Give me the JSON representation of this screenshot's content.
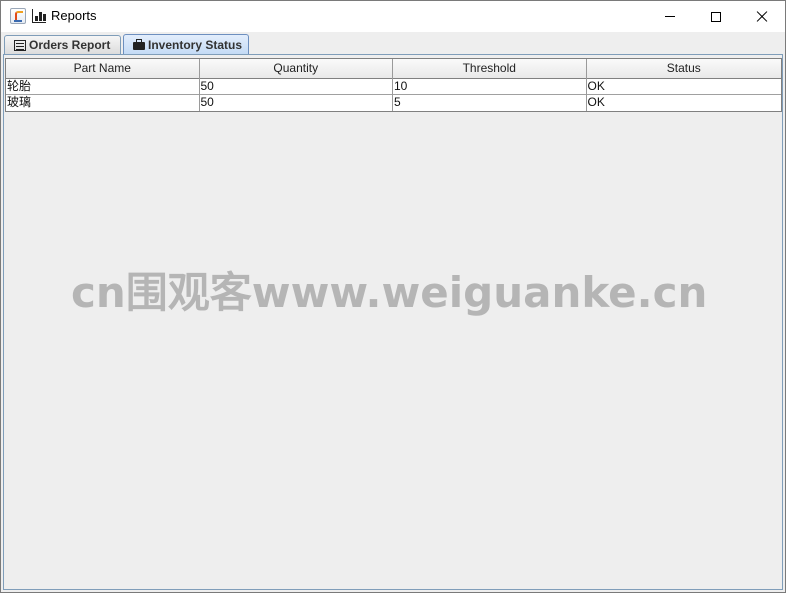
{
  "window": {
    "title": "Reports",
    "icons": {
      "app": "java-cup-icon",
      "chart": "bar-chart-icon"
    }
  },
  "tabs": [
    {
      "label": "Orders Report",
      "icon": "list-icon",
      "selected": false
    },
    {
      "label": "Inventory Status",
      "icon": "box-icon",
      "selected": true
    }
  ],
  "table": {
    "columns": [
      "Part Name",
      "Quantity",
      "Threshold",
      "Status"
    ],
    "rows": [
      [
        "轮胎",
        "50",
        "10",
        "OK"
      ],
      [
        "玻璃",
        "50",
        "5",
        "OK"
      ]
    ]
  },
  "watermark": "cn围观客www.weiguanke.cn",
  "colors": {
    "selected_tab": "#c4dbf5",
    "border": "#7f9db9",
    "background": "#eeeeee"
  }
}
